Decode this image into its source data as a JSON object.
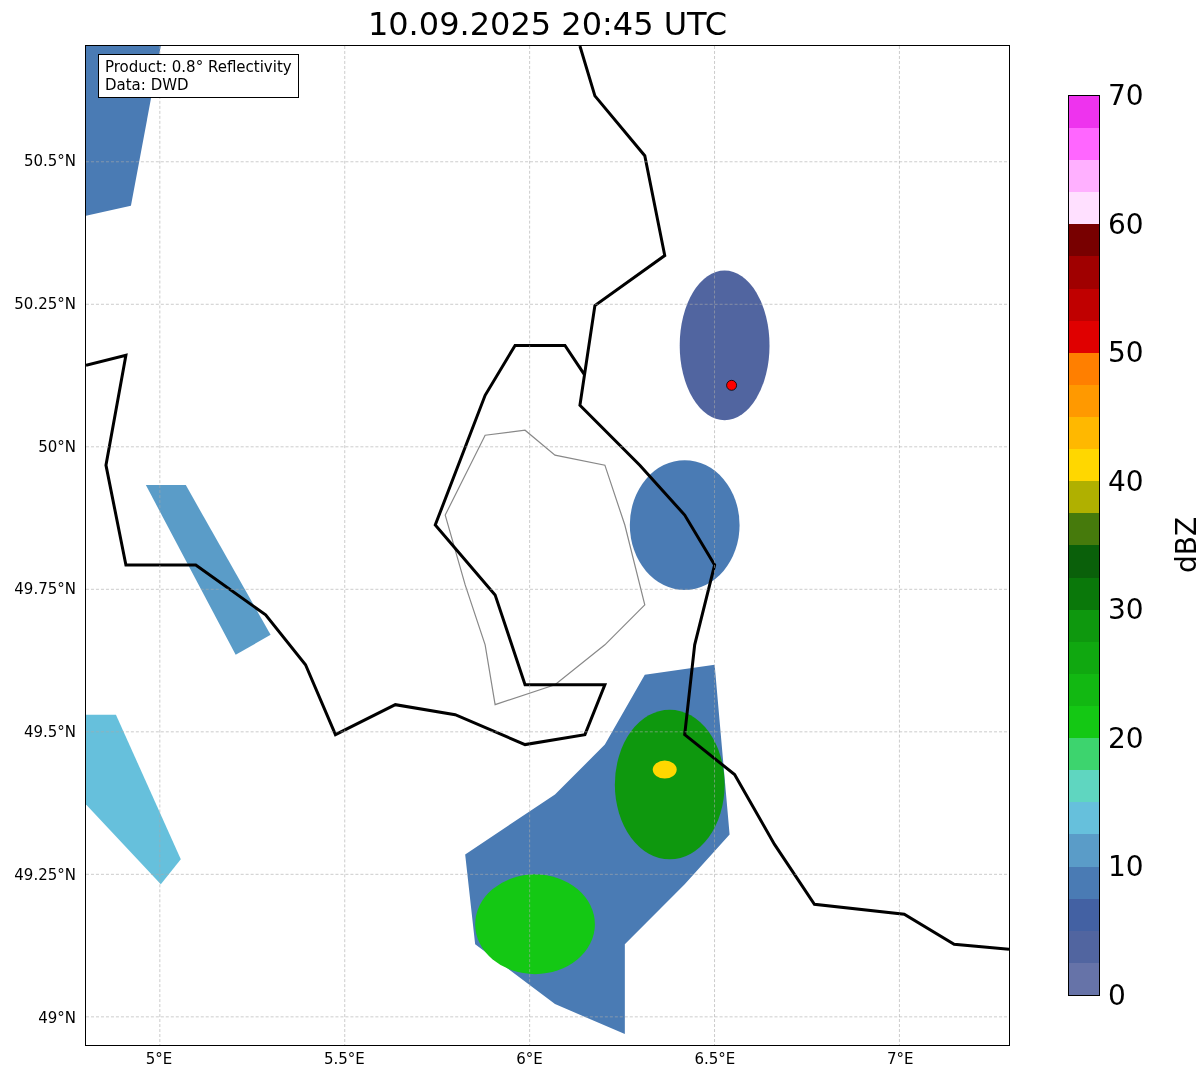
{
  "title": "10.09.2025 20:45 UTC",
  "legend": {
    "lines": [
      "Product: 0.8° Reflectivity",
      "Data: DWD"
    ]
  },
  "y_ticks": [
    "50.5°N",
    "50.25°N",
    "50°N",
    "49.75°N",
    "49.5°N",
    "49.25°N",
    "49°N"
  ],
  "x_ticks": [
    "5°E",
    "5.5°E",
    "6°E",
    "6.5°E",
    "7°E"
  ],
  "colorbar": {
    "label": "dBZ",
    "ticks": [
      "70",
      "60",
      "50",
      "40",
      "30",
      "20",
      "10",
      "0"
    ],
    "bins": [
      {
        "color": "#6673a8"
      },
      {
        "color": "#5165a0"
      },
      {
        "color": "#4361a3"
      },
      {
        "color": "#4a7bb4"
      },
      {
        "color": "#5a9cc8"
      },
      {
        "color": "#66c0dc"
      },
      {
        "color": "#5fd6c0"
      },
      {
        "color": "#3dd46e"
      },
      {
        "color": "#14c814"
      },
      {
        "color": "#12b812"
      },
      {
        "color": "#10a810"
      },
      {
        "color": "#0e980e"
      },
      {
        "color": "#0a780a"
      },
      {
        "color": "#0a600a"
      },
      {
        "color": "#467a0c"
      },
      {
        "color": "#b0b000"
      },
      {
        "color": "#ffd700"
      },
      {
        "color": "#ffb800"
      },
      {
        "color": "#ff9900"
      },
      {
        "color": "#ff7f00"
      },
      {
        "color": "#e00000"
      },
      {
        "color": "#c00000"
      },
      {
        "color": "#a00000"
      },
      {
        "color": "#780000"
      },
      {
        "color": "#ffe0ff"
      },
      {
        "color": "#ffb0ff"
      },
      {
        "color": "#ff66ff"
      },
      {
        "color": "#ee33ee"
      }
    ]
  }
}
